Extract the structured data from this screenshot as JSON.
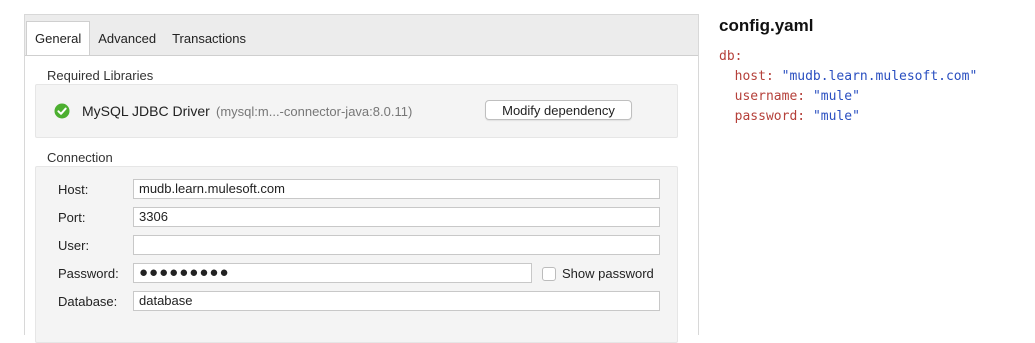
{
  "tabs": [
    "General",
    "Advanced",
    "Transactions"
  ],
  "required_libraries": {
    "title": "Required Libraries",
    "driver_name": "MySQL JDBC Driver",
    "driver_detail": "(mysql:m...-connector-java:8.0.11)",
    "modify_label": "Modify dependency"
  },
  "connection": {
    "title": "Connection",
    "fields": {
      "host": {
        "label": "Host:",
        "value": "mudb.learn.mulesoft.com"
      },
      "port": {
        "label": "Port:",
        "value": "3306"
      },
      "user": {
        "label": "User:",
        "value": ""
      },
      "password": {
        "label": "Password:",
        "value": "●●●●●●●●●"
      },
      "database": {
        "label": "Database:",
        "value": "database"
      }
    },
    "show_password_label": "Show password",
    "show_password_checked": false
  },
  "config": {
    "title": "config.yaml",
    "root_key": "db:",
    "host_key": "host:",
    "host_value": "\"mudb.learn.mulesoft.com\"",
    "username_key": "username:",
    "username_value": "\"mule\"",
    "password_key": "password:",
    "password_value": "\"mule\""
  },
  "colors": {
    "key": "#b5403a",
    "string": "#2a4fc0",
    "check_green": "#4caf30"
  }
}
